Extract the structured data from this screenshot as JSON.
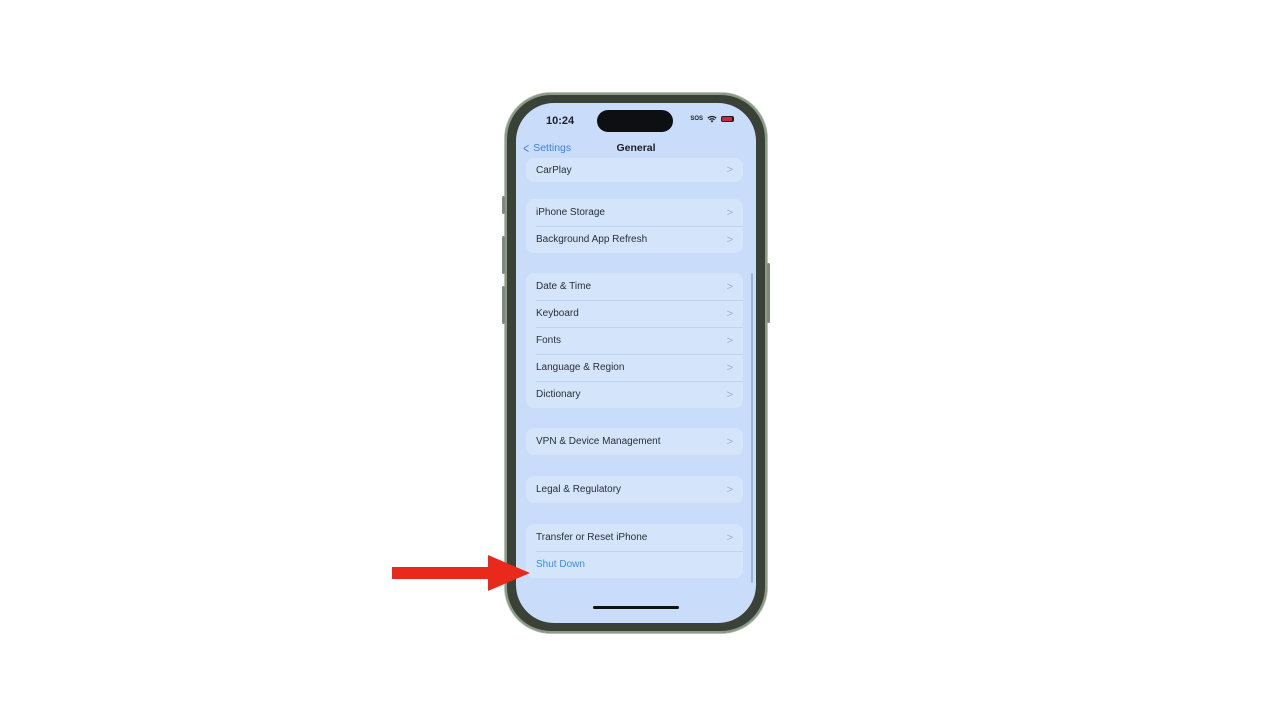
{
  "status_bar": {
    "time": "10:24",
    "carrier": "SOS"
  },
  "nav": {
    "back_label": "Settings",
    "title": "General"
  },
  "groups": [
    {
      "items": [
        {
          "label": "CarPlay"
        }
      ]
    },
    {
      "items": [
        {
          "label": "iPhone Storage"
        },
        {
          "label": "Background App Refresh"
        }
      ]
    },
    {
      "items": [
        {
          "label": "Date & Time"
        },
        {
          "label": "Keyboard"
        },
        {
          "label": "Fonts"
        },
        {
          "label": "Language & Region"
        },
        {
          "label": "Dictionary"
        }
      ]
    },
    {
      "items": [
        {
          "label": "VPN & Device Management"
        }
      ]
    },
    {
      "items": [
        {
          "label": "Legal & Regulatory"
        }
      ]
    },
    {
      "items": [
        {
          "label": "Transfer or Reset iPhone"
        },
        {
          "label": "Shut Down"
        }
      ]
    }
  ],
  "colors": {
    "accent": "#3b82e6",
    "arrow": "#e8291c",
    "screen_bg": "#c9dcf9"
  },
  "icons": {
    "back": "chevron-left-icon",
    "row": "chevron-right-icon",
    "wifi": "wifi-icon",
    "battery": "battery-icon"
  }
}
